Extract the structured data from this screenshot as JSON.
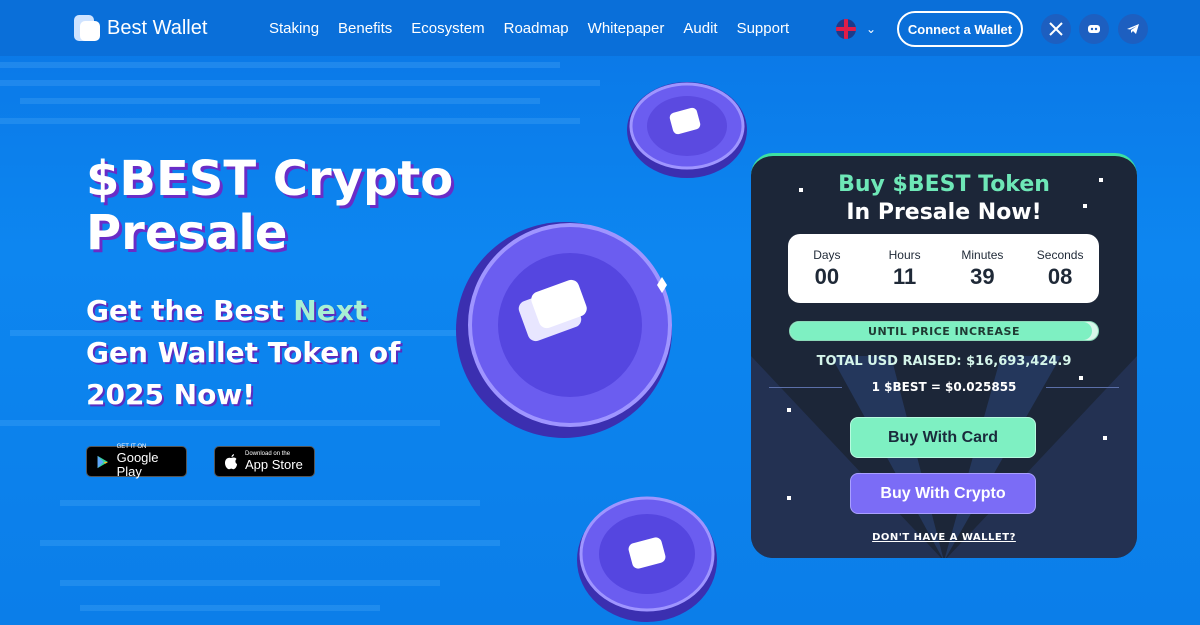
{
  "brand": {
    "name": "Best Wallet"
  },
  "nav": {
    "items": [
      "Staking",
      "Benefits",
      "Ecosystem",
      "Roadmap",
      "Whitepaper",
      "Audit",
      "Support"
    ]
  },
  "header": {
    "connect_label": "Connect a Wallet",
    "social": [
      "x-icon",
      "discord-icon",
      "telegram-icon"
    ]
  },
  "hero": {
    "title": "$BEST Crypto Presale",
    "subtitle_parts": [
      "Get the Best ",
      "Next",
      " Gen Wallet Token of 2025 Now!"
    ],
    "google_small": "GET IT ON",
    "google_big": "Google Play",
    "apple_small": "Download on the",
    "apple_big": "App Store"
  },
  "presale": {
    "title_line1": "Buy $BEST Token",
    "title_line2": "In Presale Now!",
    "countdown": [
      {
        "label": "Days",
        "value": "00"
      },
      {
        "label": "Hours",
        "value": "11"
      },
      {
        "label": "Minutes",
        "value": "39"
      },
      {
        "label": "Seconds",
        "value": "08"
      }
    ],
    "progress_label": "UNTIL PRICE INCREASE",
    "progress_fraction": 0.98,
    "raised": "TOTAL USD RAISED: $16,693,424.9",
    "rate": "1 $BEST = $0.025855",
    "buy_card": "Buy With Card",
    "buy_crypto": "Buy With Crypto",
    "no_wallet": "DON'T HAVE A WALLET?"
  },
  "colors": {
    "accent_green": "#7ef0c2",
    "accent_purple": "#7b6cf6",
    "bg_blue": "#0d86f0",
    "panel_bg": "#1c2638"
  }
}
